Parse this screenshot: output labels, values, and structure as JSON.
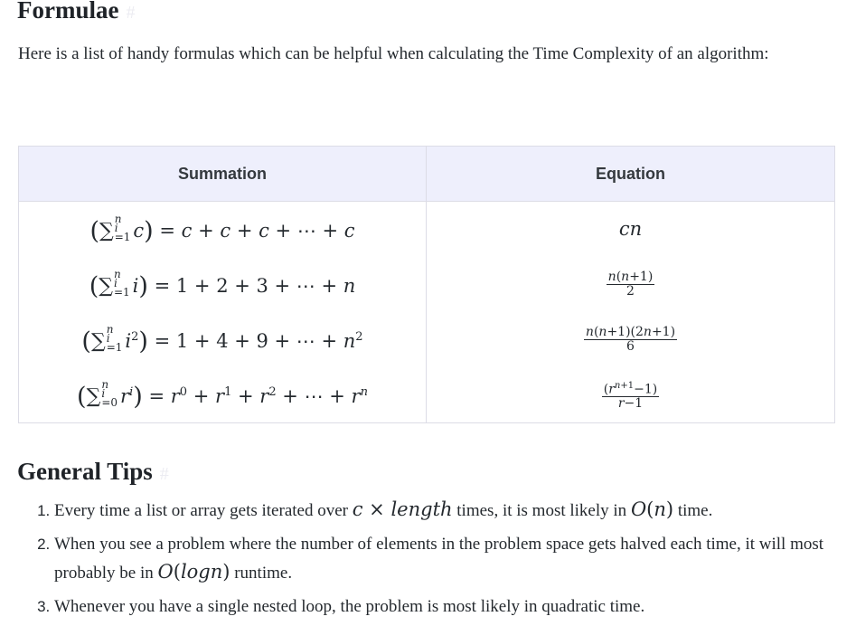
{
  "sections": {
    "formulae": {
      "title": "Formulae",
      "anchor": "#"
    },
    "tips": {
      "title": "General Tips",
      "anchor": "#"
    }
  },
  "intro": "Here is a list of handy formulas which can be helpful when calculating the Time Complexity of an algorithm:",
  "table": {
    "headers": [
      "Summation",
      "Equation"
    ],
    "rows": [
      {
        "summation": "(∑_{i=1}^{n} c) = c + c + c + ⋯ + c",
        "equation": "cn"
      },
      {
        "summation": "(∑_{i=1}^{n} i) = 1 + 2 + 3 + ⋯ + n",
        "equation": "n(n+1) / 2"
      },
      {
        "summation": "(∑_{i=1}^{n} i²) = 1 + 4 + 9 + ⋯ + n²",
        "equation": "n(n+1)(2n+1) / 6"
      },
      {
        "summation": "(∑_{i=0}^{n} rⁱ) = r⁰ + r¹ + r² + ⋯ + rⁿ",
        "equation": "(r^{n+1} − 1) / (r − 1)"
      }
    ]
  },
  "tips": [
    {
      "before": "Every time a list or array gets iterated over ",
      "math1": "c × length",
      "after": " times, it is most likely in ",
      "math2": "O(n)",
      "end": " time."
    },
    {
      "before": "When you see a problem where the number of elements in the problem space gets halved each time, it will most probably be in ",
      "math1": "O(logn)",
      "end": " runtime."
    },
    {
      "text": "Whenever you have a single nested loop, the problem is most likely in quadratic time."
    }
  ]
}
